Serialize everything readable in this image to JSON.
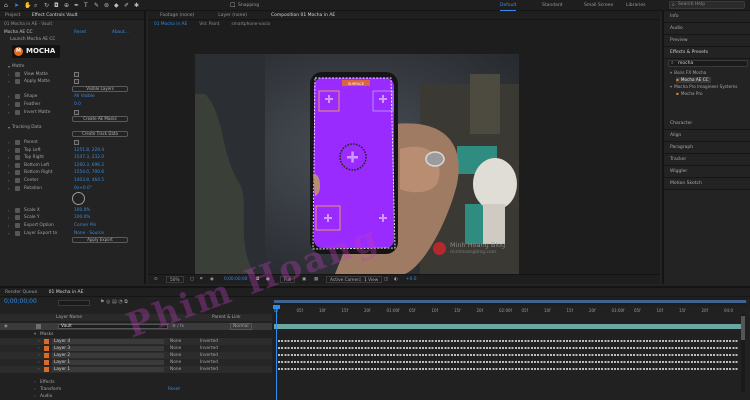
{
  "app": {
    "menu_icons": [
      "home-icon",
      "selection-tool-icon",
      "hand-tool-icon",
      "zoom-tool-icon",
      "rotate-tool-icon",
      "camera-tool-icon",
      "pan-behind-icon",
      "pen-tool-icon",
      "type-tool-icon",
      "brush-tool-icon",
      "clone-stamp-icon",
      "eraser-icon",
      "roto-brush-icon",
      "puppet-pin-icon"
    ],
    "snapping_label": "Snapping",
    "workspaces": [
      {
        "label": "Default",
        "active": true
      },
      {
        "label": "Standard",
        "active": false
      },
      {
        "label": "Small Screen",
        "active": false
      },
      {
        "label": "Libraries",
        "active": false
      }
    ],
    "search_placeholder": "Search Help"
  },
  "effect_controls": {
    "tab_project": "Project",
    "tab_effect": "Effect Controls Vault",
    "layer_ref": "01 Mocha in AE · Vault",
    "fx_name": "Mocha AE CC",
    "reset": "Reset",
    "about": "About...",
    "launch": "Launch Mocha AE CC",
    "logo_text": "MOCHA",
    "rows": [
      {
        "label": "Matte",
        "type": "group"
      },
      {
        "label": "View Matte",
        "type": "check"
      },
      {
        "label": "Apply Matte",
        "type": "check"
      },
      {
        "label": "",
        "type": "button",
        "value": "Visible Layers"
      },
      {
        "label": "Shape",
        "type": "value",
        "value": "All Visible"
      },
      {
        "label": "Feather",
        "type": "value",
        "value": "0.0"
      },
      {
        "label": "Invert Matte",
        "type": "check"
      },
      {
        "label": "",
        "type": "button",
        "value": "Create AE Masks"
      },
      {
        "label": "Tracking Data",
        "type": "group"
      },
      {
        "label": "",
        "type": "button",
        "value": "Create Track Data"
      },
      {
        "label": "Parent",
        "type": "check"
      },
      {
        "label": "Top Left",
        "type": "value",
        "value": "1251.8, 229.4"
      },
      {
        "label": "Top Right",
        "type": "value",
        "value": "1547.3, 232.0"
      },
      {
        "label": "Bottom Left",
        "type": "value",
        "value": "1260.3, 696.2"
      },
      {
        "label": "Bottom Right",
        "type": "value",
        "value": "1554.0, 700.6"
      },
      {
        "label": "Center",
        "type": "value",
        "value": "1403.8, 464.5"
      },
      {
        "label": "Rotation",
        "type": "value",
        "value": "0x+0.0°"
      },
      {
        "label": "",
        "type": "dial"
      },
      {
        "label": "Scale X",
        "type": "value",
        "value": "100.0%"
      },
      {
        "label": "Scale Y",
        "type": "value",
        "value": "100.0%"
      },
      {
        "label": "Export Option",
        "type": "value",
        "value": "Corner Pin"
      },
      {
        "label": "Layer Export to",
        "type": "value",
        "value": "None  ·  Source"
      },
      {
        "label": "",
        "type": "button",
        "value": "Apply Export"
      }
    ]
  },
  "viewer": {
    "tabs": [
      {
        "label": "Footage (none)"
      },
      {
        "label": "Layer (none)"
      },
      {
        "label": "Composition 01 Mocha in AE",
        "active": true
      }
    ],
    "subtabs": [
      "01 Mocha in AE",
      "Vid: Paint",
      "smartphone-vacio"
    ],
    "track_label": "SURFACE",
    "watermark_brand": "Minh Hoang Blog",
    "watermark_url": "minhhoangblog.com",
    "bar": {
      "zoom": "50%",
      "timecode": "0;00;00;00",
      "resolution": "Full",
      "camera": "Active Camera",
      "views": "1 View",
      "exposure": "+0.0"
    }
  },
  "right_panel": {
    "items": [
      "Info",
      "Audio",
      "Preview",
      "Effects & Presets"
    ],
    "search_value": "mocha",
    "tree": [
      {
        "label": "Boris FX Mocha",
        "indent": 0
      },
      {
        "label": "Mocha AE CC",
        "indent": 1,
        "selected": true
      },
      {
        "label": "Mocha Pro Imagineer Systems",
        "indent": 0
      },
      {
        "label": "Mocha Pro",
        "indent": 1
      }
    ],
    "panels": [
      "Character",
      "Align",
      "Paragraph",
      "Tracker",
      "Wiggler",
      "Motion Sketch"
    ]
  },
  "timeline": {
    "render_queue": "Render Queue",
    "comp_tab": "01 Mocha in AE",
    "timecode": "0;00;00;00",
    "col_layer": "Layer Name",
    "col_parent": "Parent & Link",
    "layer_name": "Vault",
    "mode": "Normal",
    "parent_none": "None",
    "masks_label": "Masks",
    "effects_label": "Effects",
    "transform_label": "Transform",
    "audio_label": "Audio",
    "reset_label": "Reset",
    "masks": [
      {
        "name": "Layer 4",
        "mode": "None",
        "inverted": "Inverted"
      },
      {
        "name": "Layer 3",
        "mode": "None",
        "inverted": "Inverted"
      },
      {
        "name": "Layer 2",
        "mode": "None",
        "inverted": "Inverted"
      },
      {
        "name": "Layer 1",
        "mode": "None",
        "inverted": "Inverted"
      },
      {
        "name": "Layer 1",
        "mode": "None",
        "inverted": "Inverted"
      }
    ],
    "ruler": [
      "0f",
      "05f",
      "10f",
      "15f",
      "20f",
      "01:00f",
      "05f",
      "10f",
      "15f",
      "20f",
      "02:00f",
      "05f",
      "10f",
      "15f",
      "20f",
      "03:00f",
      "05f",
      "10f",
      "15f",
      "20f",
      "04:0"
    ]
  },
  "watermark_text": "Phim Hoang",
  "colors": {
    "accent": "#2d8cf0",
    "purple": "#9a2bff",
    "orange": "#d86b2a"
  }
}
